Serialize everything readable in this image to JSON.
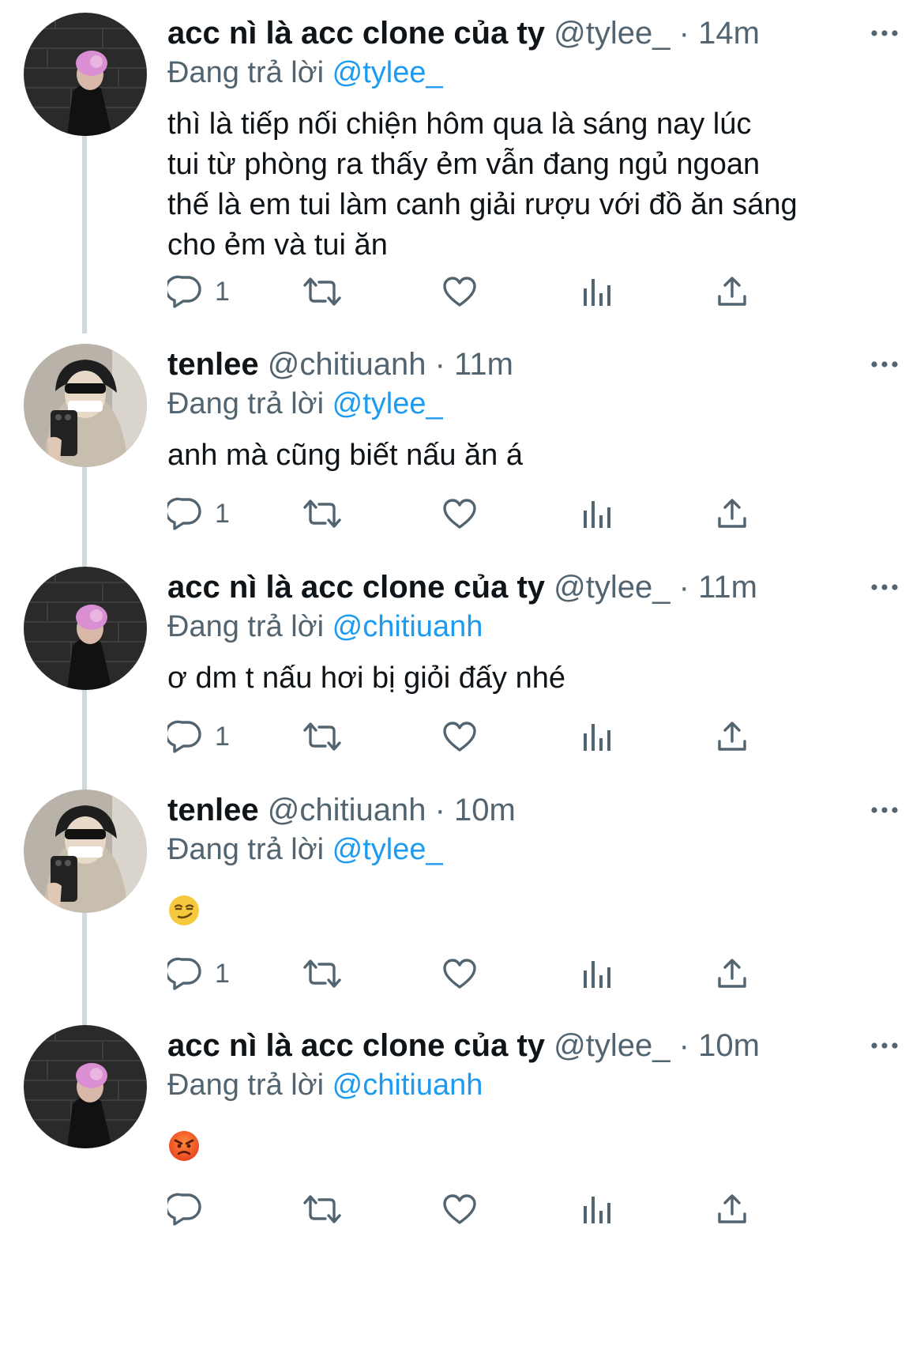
{
  "tweets": [
    {
      "name": "acc nì là acc clone của ty",
      "handle": "@tylee_",
      "dot": "·",
      "time": "14m",
      "reply_prefix": "Đang trả lời",
      "reply_to": "@tylee_",
      "body": [
        "thì là tiếp nối chiện hôm qua là sáng nay lúc",
        "tui từ phòng ra thấy ẻm vẫn đang ngủ ngoan",
        "thế là em tui làm canh giải rượu với đồ ăn sáng",
        "cho ẻm và tui ăn"
      ],
      "reply_count": "1",
      "avatar": "pink-hair-avatar"
    },
    {
      "name": "tenlee",
      "handle": "@chitiuanh",
      "dot": "·",
      "time": "11m",
      "reply_prefix": "Đang trả lời",
      "reply_to": "@tylee_",
      "body": [
        "anh mà cũng biết nấu ăn á"
      ],
      "reply_count": "1",
      "avatar": "sunglasses-hoodie-avatar"
    },
    {
      "name": "acc nì là acc clone của ty",
      "handle": "@tylee_",
      "dot": "·",
      "time": "11m",
      "reply_prefix": "Đang trả lời",
      "reply_to": "@chitiuanh",
      "body": [
        "ơ dm t nấu hơi bị giỏi đấy nhé"
      ],
      "reply_count": "1",
      "avatar": "pink-hair-avatar"
    },
    {
      "name": "tenlee",
      "handle": "@chitiuanh",
      "dot": "·",
      "time": "10m",
      "reply_prefix": "Đang trả lời",
      "reply_to": "@tylee_",
      "emoji": "smirking-face-emoji",
      "reply_count": "1",
      "avatar": "sunglasses-hoodie-avatar"
    },
    {
      "name": "acc nì là acc clone của ty",
      "handle": "@tylee_",
      "dot": "·",
      "time": "10m",
      "reply_prefix": "Đang trả lời",
      "reply_to": "@chitiuanh",
      "emoji": "angry-face-emoji",
      "reply_count": "",
      "avatar": "pink-hair-avatar"
    }
  ],
  "icons": {
    "reply": "reply-icon",
    "retweet": "retweet-icon",
    "like": "like-icon",
    "views": "views-icon",
    "share": "share-icon",
    "more": "more-icon"
  },
  "colors": {
    "text": "#0f1419",
    "secondary": "#536471",
    "mention": "#1d9bf0",
    "thread_line": "#cfd9de"
  }
}
